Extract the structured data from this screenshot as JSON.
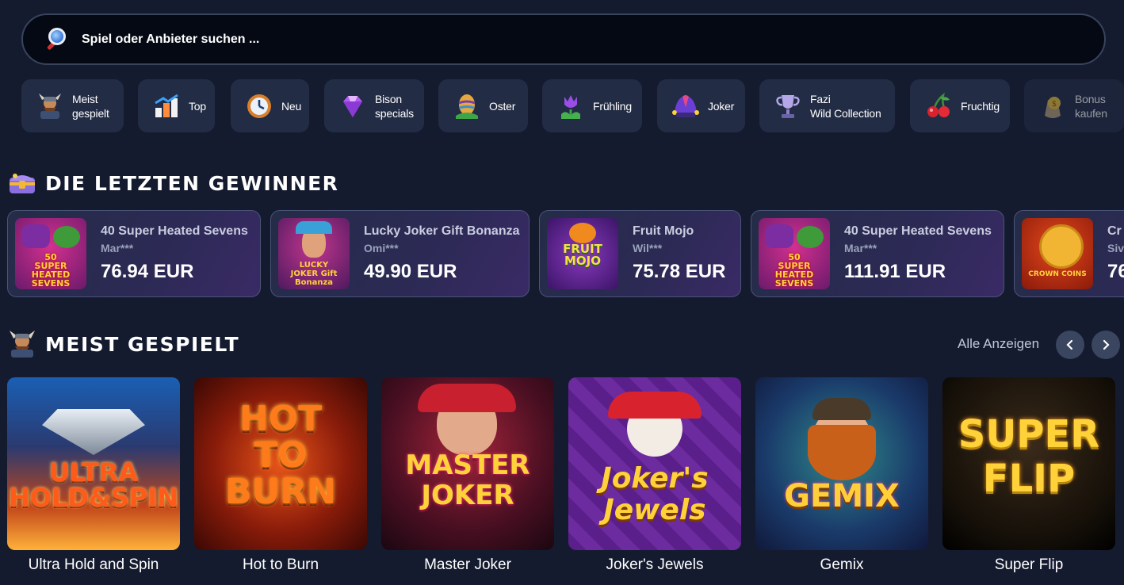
{
  "search": {
    "placeholder": "Spiel oder Anbieter suchen ..."
  },
  "categories": [
    {
      "label": "Meist\ngespielt",
      "icon": "viking-icon"
    },
    {
      "label": "Top",
      "icon": "chart-blocks-icon"
    },
    {
      "label": "Neu",
      "icon": "clock-icon"
    },
    {
      "label": "Bison\nspecials",
      "icon": "diamond-icon"
    },
    {
      "label": "Oster",
      "icon": "easter-egg-icon"
    },
    {
      "label": "Frühling",
      "icon": "tulip-icon"
    },
    {
      "label": "Joker",
      "icon": "jester-hat-icon"
    },
    {
      "label": "Fazi\nWild Collection",
      "icon": "trophy-icon"
    },
    {
      "label": "Fruchtig",
      "icon": "cherry-icon"
    },
    {
      "label": "Bonus\nkaufen",
      "icon": "coin-bag-icon"
    }
  ],
  "winners_section": {
    "title": "Die letzten Gewinner"
  },
  "winners": [
    {
      "game": "40 Super Heated Sevens",
      "user": "Mar***",
      "amount": "76.94 EUR",
      "thumb_text": "50\nSUPER HEATED\nSEVENS"
    },
    {
      "game": "Lucky Joker Gift Bonanza",
      "user": "Omi***",
      "amount": "49.90 EUR",
      "thumb_text": "LUCKY\nJOKER Gift Bonanza"
    },
    {
      "game": "Fruit Mojo",
      "user": "Wil***",
      "amount": "75.78 EUR",
      "thumb_text": "FRUIT\nMOJO"
    },
    {
      "game": "40 Super Heated Sevens",
      "user": "Mar***",
      "amount": "111.91 EUR",
      "thumb_text": "50\nSUPER HEATED\nSEVENS"
    },
    {
      "game": "Cr",
      "user": "Siv",
      "amount": "76",
      "thumb_text": "CROWN COINS"
    }
  ],
  "most_played": {
    "title": "Meist gespielt",
    "show_all": "Alle Anzeigen",
    "games": [
      {
        "name": "Ultra Hold and Spin",
        "logo": "ULTRA\nHOLD&SPIN"
      },
      {
        "name": "Hot to Burn",
        "logo": "HOT\nTO\nBURN"
      },
      {
        "name": "Master Joker",
        "logo": "MASTER\nJOKER"
      },
      {
        "name": "Joker's Jewels",
        "logo": "Joker's\nJewels"
      },
      {
        "name": "Gemix",
        "logo": "GEMIX"
      },
      {
        "name": "Super Flip",
        "logo": "SUPER\nFLIP"
      }
    ]
  }
}
